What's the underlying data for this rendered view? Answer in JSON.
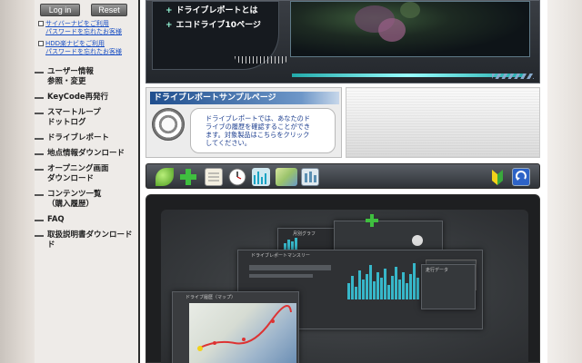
{
  "sidebar": {
    "login_label": "Log in",
    "reset_label": "Reset",
    "forgot_links": [
      "サイバーナビをご利用",
      "パスワードを忘れたお客様",
      "HDD楽ナビをご利用",
      "パスワードを忘れたお客様"
    ],
    "nav_items": [
      [
        "ユーザー情報",
        "参照・変更"
      ],
      [
        "KeyCode再発行"
      ],
      [
        "スマートループ",
        "ドットログ"
      ],
      [
        "ドライブレポート"
      ],
      [
        "地点情報ダウンロード"
      ],
      [
        "オープニング画面",
        "ダウンロード"
      ],
      [
        "コンテンツ一覧",
        "（購入履歴）"
      ],
      [
        "FAQ"
      ],
      [
        "取扱説明書ダウンロード",
        "ド"
      ]
    ]
  },
  "banner": {
    "links": [
      "ドライブレポートとは",
      "エコドライブ10ページ"
    ]
  },
  "sample": {
    "title": "ドライブレポートサンプルページ",
    "lines": [
      "ドライブレポートでは、あなたのド",
      "ライブの履歴を確認することができ",
      "ます。対象製品はこちらをクリック",
      "してください。"
    ]
  },
  "toolbar": {
    "icons": [
      "leaf-icon",
      "plus-icon",
      "document-icon",
      "clock-icon",
      "bar-chart-icon",
      "map-icon",
      "gauge-icon",
      "beginner-mark-icon",
      "back-icon"
    ]
  },
  "screenshot": {
    "panel1": "ドライブ履歴（マップ）",
    "panel2": "ドライブレポートマンスリー",
    "panel3": "月別グラフ",
    "panel4": "走行データ"
  },
  "colors": {
    "link": "#1a4fc4",
    "title_bar": "#1f4e8e",
    "accent_cyan": "#37b7c9"
  }
}
